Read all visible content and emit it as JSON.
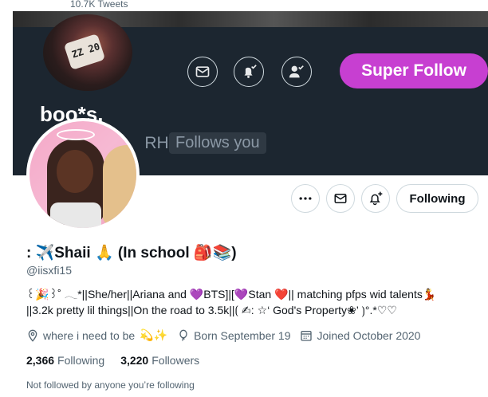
{
  "header": {
    "tweets_count": "10.7K Tweets"
  },
  "banner_profile": {
    "name": "boo*s.",
    "handle_prefix": "@",
    "handle_suffix": "RH",
    "follows_you": "Follows you",
    "mask_text": "ZZ 20",
    "super_follow_label": "Super Follow",
    "accent_color": "#c73fd1"
  },
  "profile": {
    "display_name": ": ✈️Shaii 🙏 (In school 🎒📚)",
    "handle": "@iisxfi15",
    "bio_line1": "꒰🎉꒱˚ 𓂃*||She/her||Ariana and 💜BTS]|[💜Stan ❤️|| matching pfps wid talents💃",
    "bio_line2": "||3.2k pretty lil things||On the road to 3.5k||⟮ ✍︎: ☆‘ God's Property❀’ ⟯°.*♡♡",
    "location": "where i need to be",
    "location_emoji": "💫✨",
    "birthday": "Born September 19",
    "joined": "Joined October 2020",
    "following_count": "2,366",
    "following_label": "Following",
    "followers_count": "3,220",
    "followers_label": "Followers",
    "not_followed": "Not followed by anyone you’re following"
  },
  "actions": {
    "following_button": "Following"
  },
  "icons": [
    "mail-icon",
    "bell-icon",
    "user-check-icon",
    "more-icon",
    "location-icon",
    "balloon-icon",
    "calendar-icon"
  ]
}
